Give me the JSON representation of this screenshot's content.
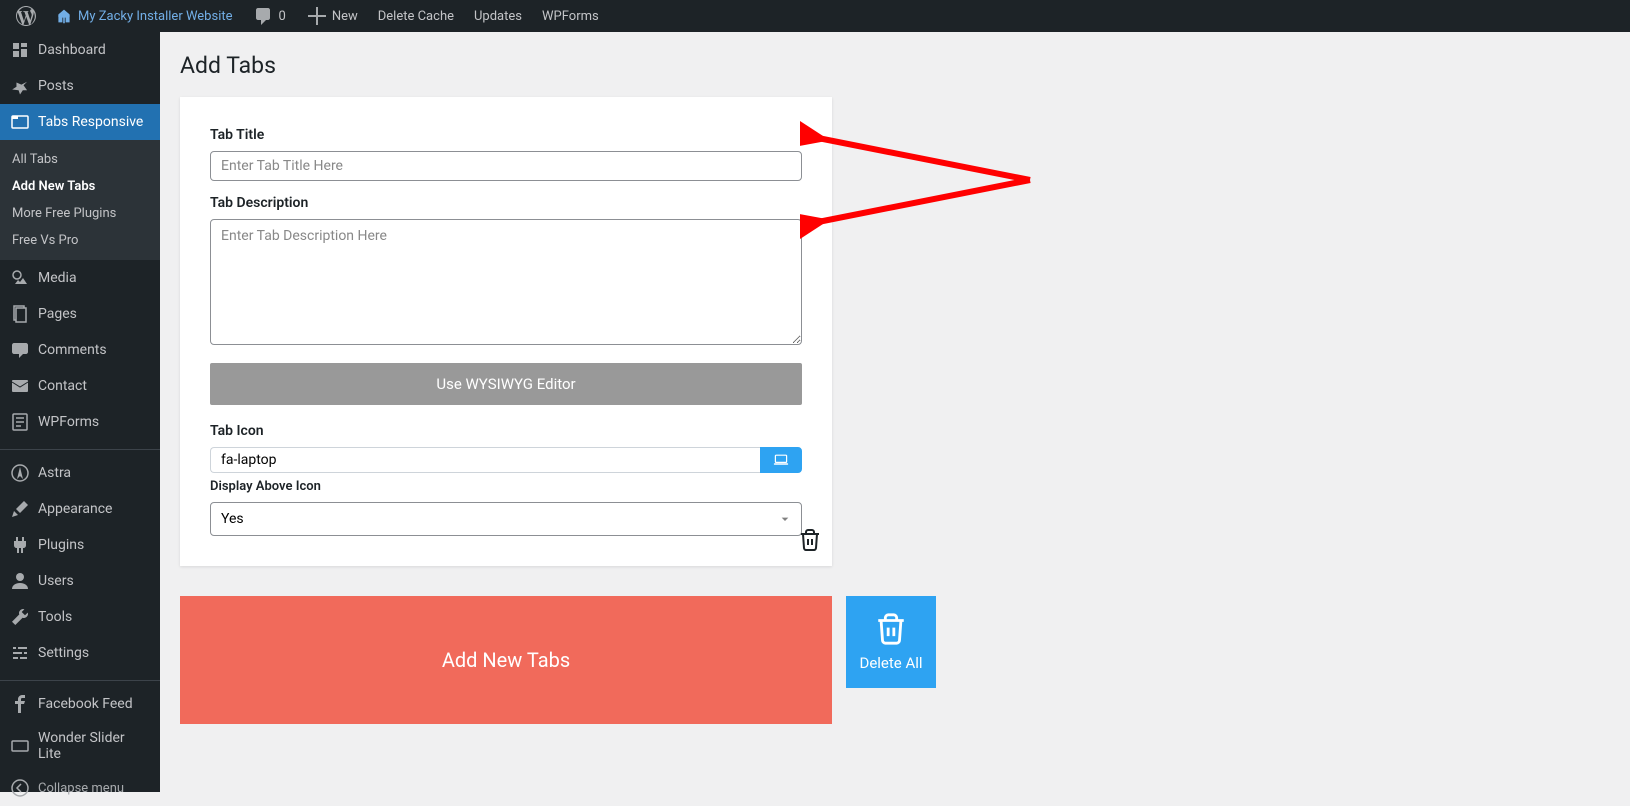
{
  "adminbar": {
    "site_name": "My Zacky Installer Website",
    "comments_count": "0",
    "new_label": "New",
    "links": [
      "Delete Cache",
      "Updates",
      "WPForms"
    ]
  },
  "sidebar": {
    "items": [
      {
        "label": "Dashboard",
        "icon": "dashboard"
      },
      {
        "label": "Posts",
        "icon": "pin"
      },
      {
        "label": "Tabs Responsive",
        "icon": "tabs",
        "current": true
      },
      {
        "label": "Media",
        "icon": "media"
      },
      {
        "label": "Pages",
        "icon": "pages"
      },
      {
        "label": "Comments",
        "icon": "comments"
      },
      {
        "label": "Contact",
        "icon": "mail"
      },
      {
        "label": "WPForms",
        "icon": "form"
      },
      {
        "label": "Astra",
        "icon": "astra"
      },
      {
        "label": "Appearance",
        "icon": "brush"
      },
      {
        "label": "Plugins",
        "icon": "plugin"
      },
      {
        "label": "Users",
        "icon": "user"
      },
      {
        "label": "Tools",
        "icon": "wrench"
      },
      {
        "label": "Settings",
        "icon": "sliders"
      },
      {
        "label": "Facebook Feed",
        "icon": "fb"
      },
      {
        "label": "Wonder Slider Lite",
        "icon": "slider"
      }
    ],
    "submenu": [
      "All Tabs",
      "Add New Tabs",
      "More Free Plugins",
      "Free Vs Pro"
    ],
    "collapse_label": "Collapse menu"
  },
  "page": {
    "title": "Add Tabs",
    "form": {
      "tab_title_label": "Tab Title",
      "tab_title_placeholder": "Enter Tab Title Here",
      "tab_desc_label": "Tab Description",
      "tab_desc_placeholder": "Enter Tab Description Here",
      "wysiwyg_button": "Use WYSIWYG Editor",
      "tab_icon_label": "Tab Icon",
      "tab_icon_value": "fa-laptop",
      "display_above_label": "Display Above Icon",
      "display_above_value": "Yes"
    },
    "add_button": "Add New Tabs",
    "delete_button": "Delete All"
  }
}
